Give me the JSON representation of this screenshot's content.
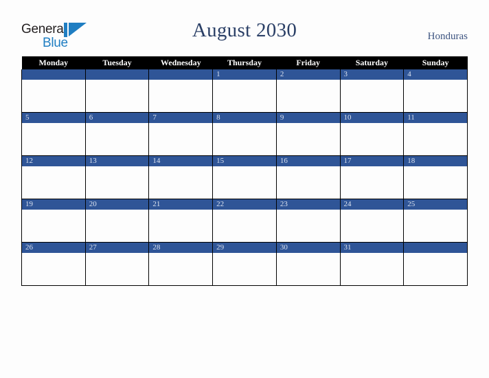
{
  "brand": {
    "name_part1": "General",
    "name_part2": "Blue",
    "accent_color": "#1f7ec2"
  },
  "header": {
    "title": "August 2030",
    "subtitle": "Honduras"
  },
  "calendar": {
    "month": "August",
    "year": "2030",
    "header_bg": "#000000",
    "day_bar_color": "#2f5597",
    "weekdays": [
      "Monday",
      "Tuesday",
      "Wednesday",
      "Thursday",
      "Friday",
      "Saturday",
      "Sunday"
    ],
    "weeks": [
      [
        "",
        "",
        "",
        "1",
        "2",
        "3",
        "4"
      ],
      [
        "5",
        "6",
        "7",
        "8",
        "9",
        "10",
        "11"
      ],
      [
        "12",
        "13",
        "14",
        "15",
        "16",
        "17",
        "18"
      ],
      [
        "19",
        "20",
        "21",
        "22",
        "23",
        "24",
        "25"
      ],
      [
        "26",
        "27",
        "28",
        "29",
        "30",
        "31",
        ""
      ]
    ]
  }
}
